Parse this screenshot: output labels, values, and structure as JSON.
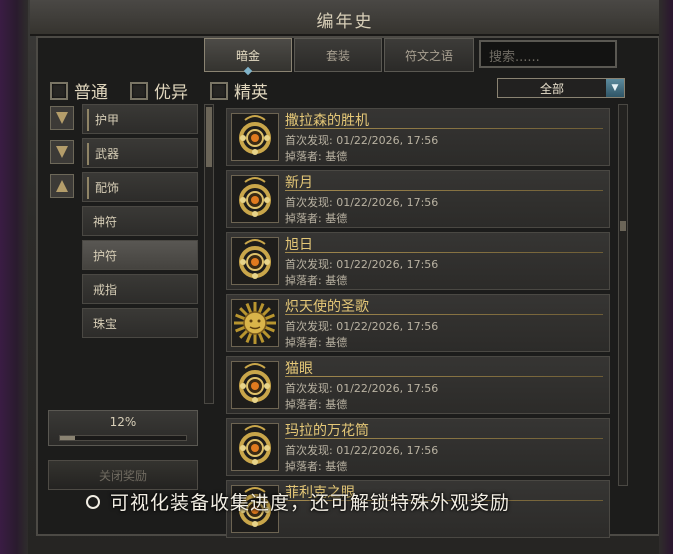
{
  "window": {
    "title": "编年史"
  },
  "tabs": [
    {
      "label": "暗金",
      "active": true
    },
    {
      "label": "套装",
      "active": false
    },
    {
      "label": "符文之语",
      "active": false
    }
  ],
  "search": {
    "placeholder": "搜索......"
  },
  "filters": [
    {
      "label": "普通",
      "checked": false
    },
    {
      "label": "优异",
      "checked": false
    },
    {
      "label": "精英",
      "checked": false
    }
  ],
  "dropdown": {
    "selected": "全部"
  },
  "sidebar": {
    "items": [
      {
        "label": "护甲",
        "toggle": "down"
      },
      {
        "label": "武器",
        "toggle": "down"
      },
      {
        "label": "配饰",
        "toggle": "up"
      },
      {
        "label": "神符"
      },
      {
        "label": "护符",
        "selected": true
      },
      {
        "label": "戒指"
      },
      {
        "label": "珠宝"
      }
    ]
  },
  "progress": {
    "label": "12%",
    "value": 0.12
  },
  "close_button": {
    "label": "关闭奖励"
  },
  "items": [
    {
      "name": "撒拉森的胜机",
      "found": "首次发现: 01/22/2026, 17:56",
      "dropper": "掉落者: 基德",
      "icon": "amulet-icon"
    },
    {
      "name": "新月",
      "found": "首次发现: 01/22/2026, 17:56",
      "dropper": "掉落者: 基德",
      "icon": "amulet-icon"
    },
    {
      "name": "旭日",
      "found": "首次发现: 01/22/2026, 17:56",
      "dropper": "掉落者: 基德",
      "icon": "amulet-icon"
    },
    {
      "name": "炽天使的圣歌",
      "found": "首次发现: 01/22/2026, 17:56",
      "dropper": "掉落者: 基德",
      "icon": "sun-amulet-icon"
    },
    {
      "name": "猫眼",
      "found": "首次发现: 01/22/2026, 17:56",
      "dropper": "掉落者: 基德",
      "icon": "amulet-icon"
    },
    {
      "name": "玛拉的万花筒",
      "found": "首次发现: 01/22/2026, 17:56",
      "dropper": "掉落者: 基德",
      "icon": "amulet-icon"
    },
    {
      "name": "菲利克之眼",
      "found": "",
      "dropper": "",
      "icon": "amulet-icon"
    }
  ],
  "caption": {
    "text": "可视化装备收集进度，还可解锁特殊外观奖励"
  },
  "colors": {
    "accent": "#e4c777",
    "tab_marker": "#7fb3c9"
  }
}
